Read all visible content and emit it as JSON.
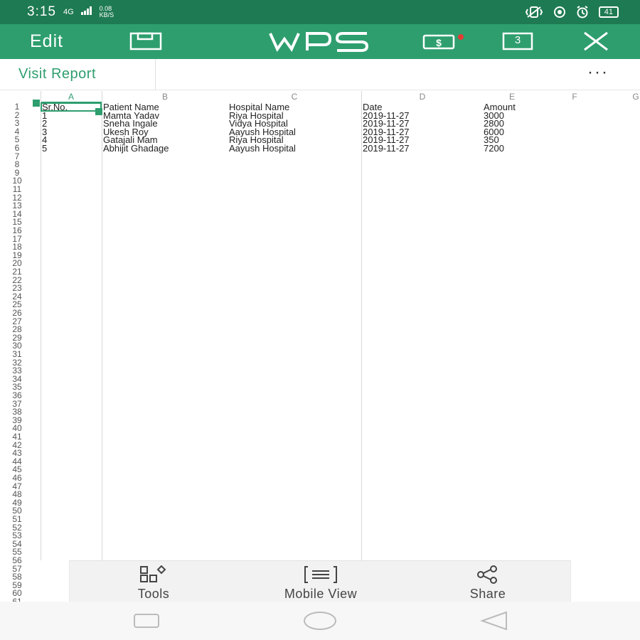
{
  "status_bar": {
    "time": "3:15",
    "signal": "4G",
    "speed_value": "0.08",
    "speed_unit": "KB/S",
    "battery": "41"
  },
  "toolbar": {
    "edit_label": "Edit",
    "logo_text": "WPS",
    "tab_count": "3",
    "accent_color": "#2e9e6e",
    "status_color": "#1e7a52"
  },
  "document": {
    "title": "Visit Report",
    "more_label": "···"
  },
  "sheet": {
    "columns": [
      "A",
      "B",
      "C",
      "D",
      "E",
      "F",
      "G"
    ],
    "selected_column": "A",
    "selected_cell": "A1",
    "rows": [
      [
        "Sr.No.",
        "Patient Name",
        "Hospital Name",
        "Date",
        "Amount"
      ],
      [
        "1",
        "Mamta Yadav",
        "Riya Hospital",
        "2019-11-27",
        "3000"
      ],
      [
        "2",
        "Sneha Ingale",
        "Vidya Hospital",
        "2019-11-27",
        "2800"
      ],
      [
        "3",
        "Ukesh Roy",
        "Aayush Hospital",
        "2019-11-27",
        "6000"
      ],
      [
        "4",
        "Gatajali Mam",
        "Riya Hospital",
        "2019-11-27",
        "350"
      ],
      [
        "5",
        "Abhijit Ghadage",
        "Aayush Hospital",
        "2019-11-27",
        "7200"
      ]
    ],
    "row_count": 61
  },
  "bottom_tools": {
    "tools_label": "Tools",
    "mobile_view_label": "Mobile View",
    "share_label": "Share"
  },
  "icons": {
    "save": "save-icon",
    "logo": "wps-logo",
    "tools": "tools-grid-icon",
    "mobile_view": "mobile-view-icon",
    "share": "share-icon"
  }
}
